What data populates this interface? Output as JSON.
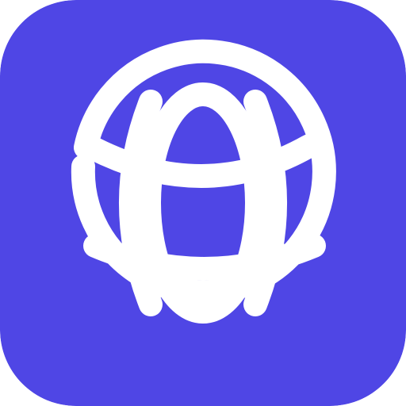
{
  "app_icon": {
    "icon": "globe-icon",
    "background_color": "#4F46E5",
    "foreground_color": "#FFFFFF"
  }
}
